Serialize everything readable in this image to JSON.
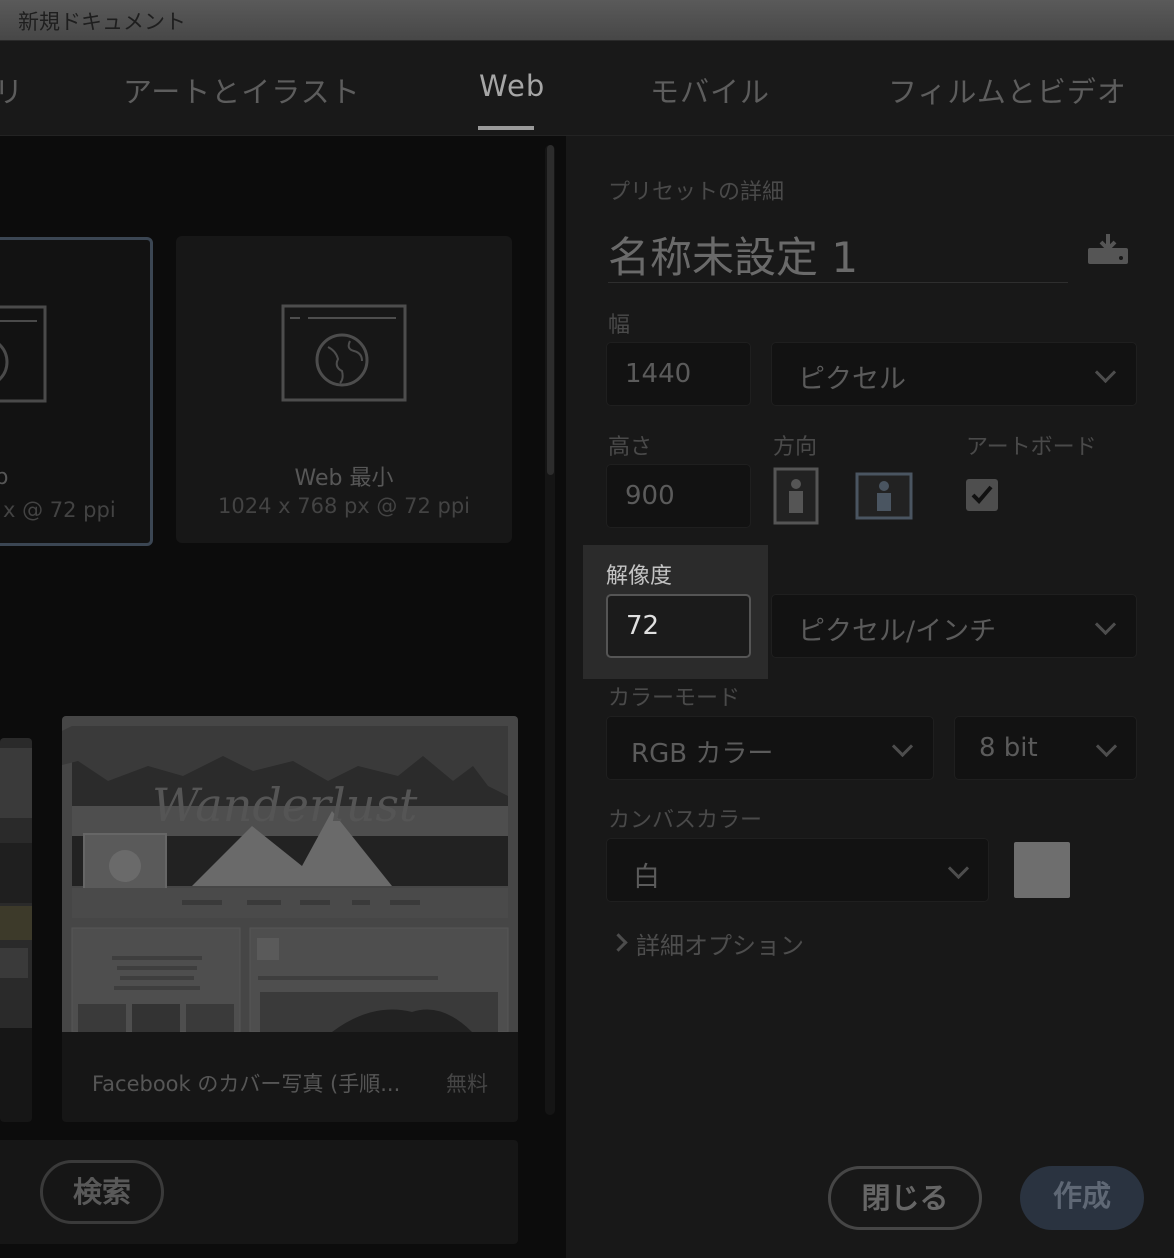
{
  "window": {
    "title": "新規ドキュメント"
  },
  "tabs": [
    {
      "label": "リ"
    },
    {
      "label": "アートとイラスト"
    },
    {
      "label": "Web"
    },
    {
      "label": "モバイル"
    },
    {
      "label": "フィルムとビデオ"
    }
  ],
  "presets": [
    {
      "name": "b",
      "size": "x @ 72 ppi"
    },
    {
      "name": "Web 最小",
      "size": "1024 x 768 px @ 72 ppi"
    }
  ],
  "templates": [
    {
      "title": "Facebook のカバー写真 (手順...",
      "price": "無料",
      "banner_text": "Wanderlust"
    }
  ],
  "bottom": {
    "search_label": "検索"
  },
  "details": {
    "section_label": "プリセットの詳細",
    "doc_name": "名称未設定 1",
    "width_label": "幅",
    "width_value": "1440",
    "width_unit": "ピクセル",
    "height_label": "高さ",
    "height_value": "900",
    "orientation_label": "方向",
    "artboard_label": "アートボード",
    "resolution_label": "解像度",
    "resolution_value": "72",
    "resolution_unit": "ピクセル/インチ",
    "color_mode_label": "カラーモード",
    "color_mode_value": "RGB カラー",
    "bit_depth_value": "8 bit",
    "canvas_color_label": "カンバスカラー",
    "canvas_color_value": "白",
    "advanced_label": "詳細オプション",
    "swatch_color": "#6e6e6e"
  },
  "buttons": {
    "close": "閉じる",
    "create": "作成"
  }
}
